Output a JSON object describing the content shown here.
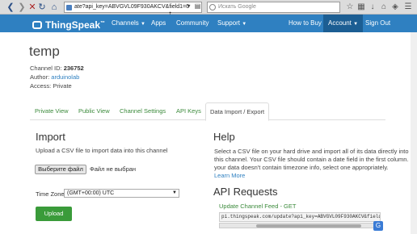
{
  "browser": {
    "url": "ate?api_key=ABVGVL09F930AKCV&field1=0",
    "search_placeholder": "Искать Google"
  },
  "navbar": {
    "brand": "ThingSpeak",
    "trademark": "™",
    "items": [
      {
        "label": "Channels",
        "has_caret": true
      },
      {
        "label": "Apps",
        "has_caret": false
      },
      {
        "label": "Community",
        "has_caret": false
      },
      {
        "label": "Support",
        "has_caret": true
      },
      {
        "label": "How to Buy",
        "has_caret": false
      },
      {
        "label": "Account",
        "has_caret": true
      },
      {
        "label": "Sign Out",
        "has_caret": false
      }
    ]
  },
  "channel": {
    "title": "temp",
    "id_label": "Channel ID:",
    "id_value": "236752",
    "author_label": "Author:",
    "author_value": "arduinolab",
    "access_label": "Access:",
    "access_value": "Private"
  },
  "tabs": [
    {
      "label": "Private View"
    },
    {
      "label": "Public View"
    },
    {
      "label": "Channel Settings"
    },
    {
      "label": "API Keys"
    },
    {
      "label": "Data Import / Export",
      "active": true
    }
  ],
  "import": {
    "title": "Import",
    "description": "Upload a CSV file to import data into this channel",
    "file_button": "Выберите файл",
    "file_status": "Файл не выбран",
    "timezone_label": "Time Zone",
    "timezone_value": "(GMT+00:00) UTC",
    "upload_button": "Upload"
  },
  "help": {
    "title": "Help",
    "line1": "Select a CSV file on your hard drive and import all of its data directly into",
    "line2": "this channel. Your CSV file should contain a date field in the first column. If",
    "line3": "your data doesn't contain timezone info, select one appropriately.",
    "learn_more": "Learn More"
  },
  "api": {
    "title": "API Requests",
    "feed_link": "Update Channel Feed - GET",
    "feed_url": "pi.thingspeak.com/update?api_key=ABVGVL09F930AKCV&field1=0"
  },
  "colors": {
    "navbar": "#2f80c1",
    "navbar_active": "#1c5e93",
    "accent_green": "#3a9b3a",
    "link_blue": "#2f80c1"
  }
}
